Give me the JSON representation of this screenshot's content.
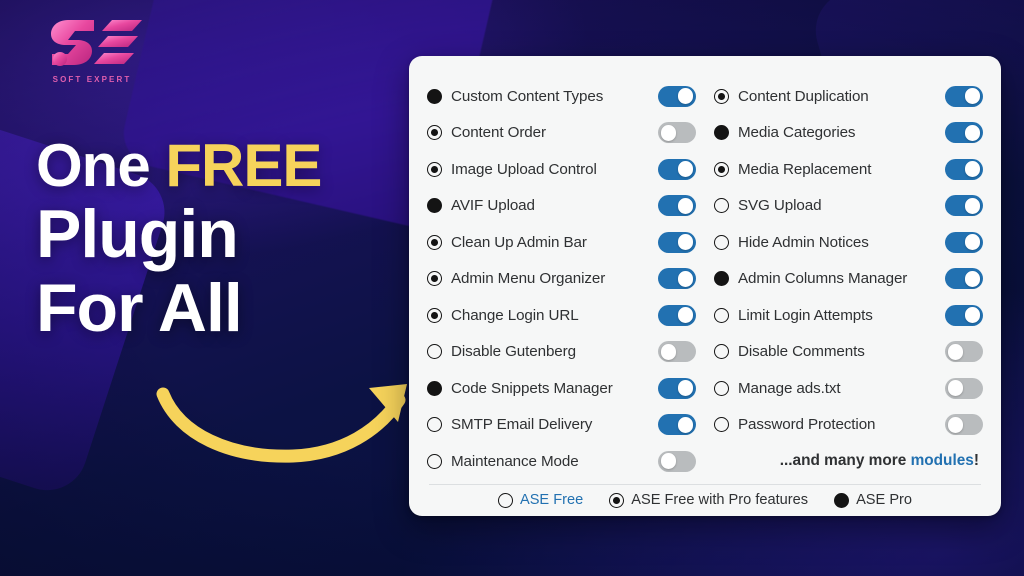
{
  "brand": {
    "logo_mark": "se-monogram",
    "logo_wordmark": "SOFT EXPERT",
    "logo_color": "#e05fae"
  },
  "headline": {
    "line1_plain": "One ",
    "line1_accent": "FREE",
    "line2": "Plugin",
    "line3": "For All",
    "accent_color": "#f6d35b",
    "text_color": "#ffffff"
  },
  "arrow": {
    "name": "curved-arrow",
    "color": "#f6d35b"
  },
  "card": {
    "accent_color": "#2271b1",
    "background": "#f6f7f7",
    "columns": [
      {
        "name": "left-column",
        "rows": [
          {
            "label": "Custom Content Types",
            "tier": "filled",
            "toggle": "on"
          },
          {
            "label": "Content Order",
            "tier": "dotted",
            "toggle": "off"
          },
          {
            "label": "Image Upload Control",
            "tier": "dotted",
            "toggle": "on"
          },
          {
            "label": "AVIF Upload",
            "tier": "filled",
            "toggle": "on"
          },
          {
            "label": "Clean Up Admin Bar",
            "tier": "dotted",
            "toggle": "on"
          },
          {
            "label": "Admin Menu Organizer",
            "tier": "dotted",
            "toggle": "on"
          },
          {
            "label": "Change Login URL",
            "tier": "dotted",
            "toggle": "on"
          },
          {
            "label": "Disable Gutenberg",
            "tier": "empty",
            "toggle": "off"
          },
          {
            "label": "Code Snippets Manager",
            "tier": "filled",
            "toggle": "on"
          },
          {
            "label": "SMTP Email Delivery",
            "tier": "empty",
            "toggle": "on"
          },
          {
            "label": "Maintenance Mode",
            "tier": "empty",
            "toggle": "off"
          }
        ]
      },
      {
        "name": "right-column",
        "rows": [
          {
            "label": "Content Duplication",
            "tier": "dotted",
            "toggle": "on"
          },
          {
            "label": "Media Categories",
            "tier": "filled",
            "toggle": "on"
          },
          {
            "label": "Media Replacement",
            "tier": "dotted",
            "toggle": "on"
          },
          {
            "label": "SVG Upload",
            "tier": "empty",
            "toggle": "on"
          },
          {
            "label": "Hide Admin Notices",
            "tier": "empty",
            "toggle": "on"
          },
          {
            "label": "Admin Columns Manager",
            "tier": "filled",
            "toggle": "on"
          },
          {
            "label": "Limit Login Attempts",
            "tier": "empty",
            "toggle": "on"
          },
          {
            "label": "Disable Comments",
            "tier": "empty",
            "toggle": "off"
          },
          {
            "label": "Manage ads.txt",
            "tier": "empty",
            "toggle": "off"
          },
          {
            "label": "Password Protection",
            "tier": "empty",
            "toggle": "off"
          }
        ]
      }
    ],
    "more_modules": {
      "prefix": "...and many more ",
      "link": "modules",
      "suffix": "!"
    },
    "legend": [
      {
        "label": "ASE Free",
        "tier": "empty",
        "link": true
      },
      {
        "label": "ASE Free with Pro features",
        "tier": "dotted",
        "link": false
      },
      {
        "label": "ASE Pro",
        "tier": "filled",
        "link": false
      }
    ]
  }
}
